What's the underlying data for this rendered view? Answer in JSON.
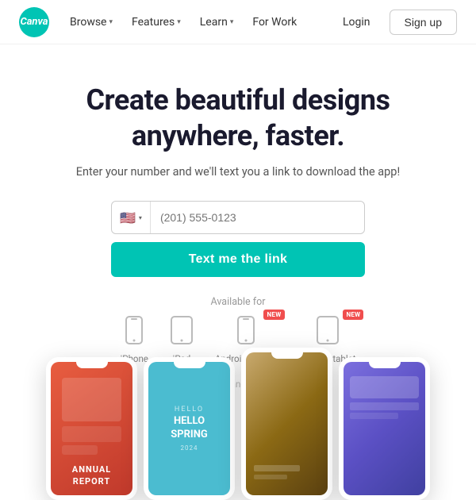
{
  "navbar": {
    "logo_text": "Canva",
    "nav_items": [
      {
        "label": "Browse",
        "has_chevron": true
      },
      {
        "label": "Features",
        "has_chevron": true
      },
      {
        "label": "Learn",
        "has_chevron": true
      },
      {
        "label": "For Work",
        "has_chevron": false
      }
    ],
    "login_label": "Login",
    "signup_label": "Sign up"
  },
  "hero": {
    "title": "Create beautiful designs\nanywhere, faster.",
    "subtitle": "Enter your number and we'll text you a link to download the app!",
    "phone_placeholder": "(201) 555-0123",
    "flag_emoji": "🇺🇸",
    "cta_button": "Text me the link"
  },
  "available": {
    "label": "Available for",
    "devices": [
      {
        "label": "iPhone",
        "icon": "📱",
        "new": false
      },
      {
        "label": "iPad",
        "icon": "⬜",
        "new": false
      },
      {
        "label": "Android mobile",
        "icon": "📱",
        "new": true
      },
      {
        "label": "Android tablet",
        "icon": "⬜",
        "new": true
      }
    ]
  },
  "disclaimer": "Standard messaging and data fees may apply.",
  "mockups": [
    {
      "screen": "annual",
      "color1": "#e85d40",
      "color2": "#c0392b"
    },
    {
      "screen": "hello_spring",
      "color1": "#4bbcd0",
      "color2": "#3aa8bc"
    },
    {
      "screen": "autumn",
      "color1": "#c8a96e",
      "color2": "#5a4010"
    },
    {
      "screen": "purple",
      "color1": "#7b6fde",
      "color2": "#4040a0"
    }
  ]
}
